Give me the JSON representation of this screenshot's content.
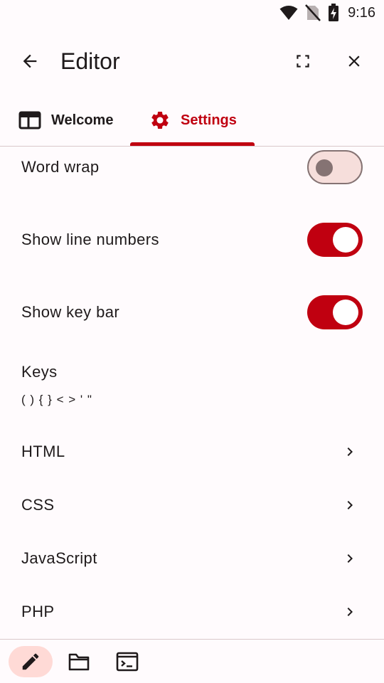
{
  "status_bar": {
    "time": "9:16",
    "icons": [
      "wifi-icon",
      "no-sim-icon",
      "battery-charging-icon"
    ]
  },
  "app_bar": {
    "title": "Editor",
    "back_icon": "arrow-back-icon",
    "fullscreen_icon": "fullscreen-icon",
    "close_icon": "close-icon"
  },
  "tabs": [
    {
      "label": "Welcome",
      "icon": "window-icon",
      "selected": false
    },
    {
      "label": "Settings",
      "icon": "gear-icon",
      "selected": true
    }
  ],
  "colors": {
    "accent": "#c00010",
    "switch_off_track": "#f6dedb",
    "switch_off_outline": "#857373",
    "editor_pill": "#ffdad6"
  },
  "settings": {
    "word_wrap": {
      "label": "Word wrap",
      "on": false
    },
    "line_numbers": {
      "label": "Show line numbers",
      "on": true
    },
    "key_bar": {
      "label": "Show key bar",
      "on": true
    },
    "keys": {
      "label": "Keys",
      "value": "( ) { } < > ' \""
    },
    "languages": [
      "HTML",
      "CSS",
      "JavaScript",
      "PHP"
    ]
  },
  "bottom_bar": {
    "items": [
      {
        "icon": "pencil-icon",
        "selected": true
      },
      {
        "icon": "folder-icon",
        "selected": false
      },
      {
        "icon": "terminal-icon",
        "selected": false
      }
    ]
  }
}
